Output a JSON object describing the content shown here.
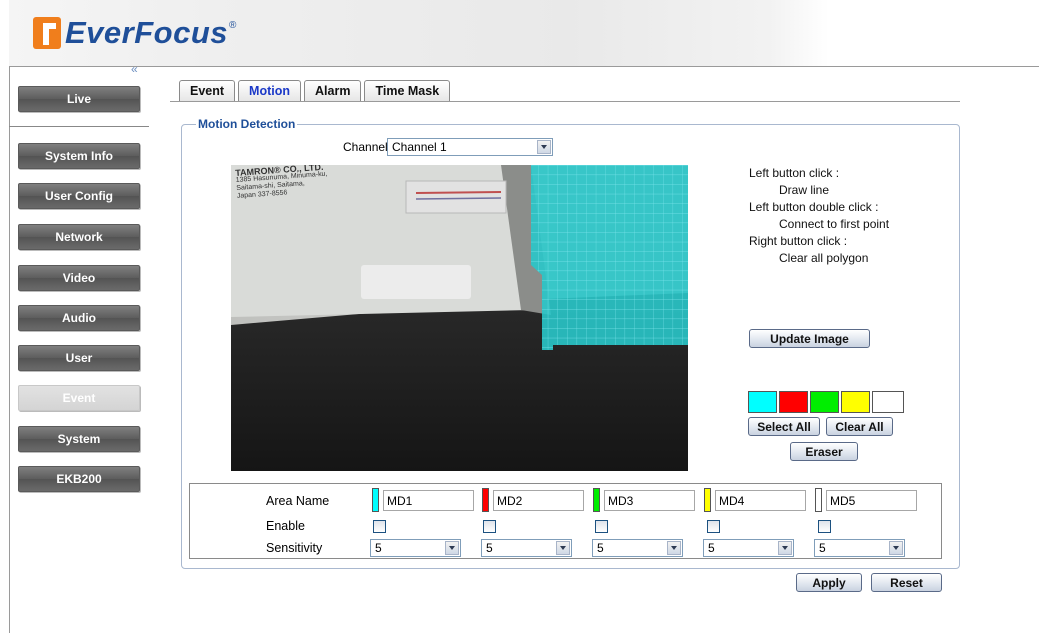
{
  "brand": {
    "name": "EverFocus",
    "mark": "®"
  },
  "sidebar": {
    "collapse_label": "«",
    "live": "Live",
    "items": [
      "System Info",
      "User Config",
      "Network",
      "Video",
      "Audio",
      "User",
      "Event",
      "System",
      "EKB200"
    ],
    "active_item": "Event"
  },
  "tabs": [
    "Event",
    "Motion",
    "Alarm",
    "Time Mask"
  ],
  "active_tab": "Motion",
  "motion": {
    "section_title": "Motion Detection",
    "channel_label": "Channel :",
    "channel_value": "Channel 1",
    "camera_label_lines": [
      "TAMRON® CO., LTD.",
      "1385 Hasunuma, Minuma-ku,",
      "Saitama-shi, Saitama,",
      "Japan 337-8556"
    ],
    "help": {
      "left_click": "Left button click :",
      "left_click_action": "Draw line",
      "double_click": "Left button double click :",
      "double_click_action": "Connect to first point",
      "right_click": "Right button click :",
      "right_click_action": "Clear all polygon"
    },
    "update_image": "Update Image",
    "palette": [
      "#00ffff",
      "#ff0000",
      "#00ee00",
      "#ffff00",
      "#ffffff"
    ],
    "select_all": "Select All",
    "clear_all": "Clear All",
    "eraser": "Eraser",
    "table": {
      "area_name_label": "Area Name",
      "enable_label": "Enable",
      "sensitivity_label": "Sensitivity",
      "areas": [
        {
          "color": "#00ffff",
          "name": "MD1",
          "enabled": false,
          "sensitivity": "5"
        },
        {
          "color": "#ff0000",
          "name": "MD2",
          "enabled": false,
          "sensitivity": "5"
        },
        {
          "color": "#00ee00",
          "name": "MD3",
          "enabled": false,
          "sensitivity": "5"
        },
        {
          "color": "#ffff00",
          "name": "MD4",
          "enabled": false,
          "sensitivity": "5"
        },
        {
          "color": "#ffffff",
          "name": "MD5",
          "enabled": false,
          "sensitivity": "5"
        }
      ]
    },
    "apply": "Apply",
    "reset": "Reset"
  }
}
